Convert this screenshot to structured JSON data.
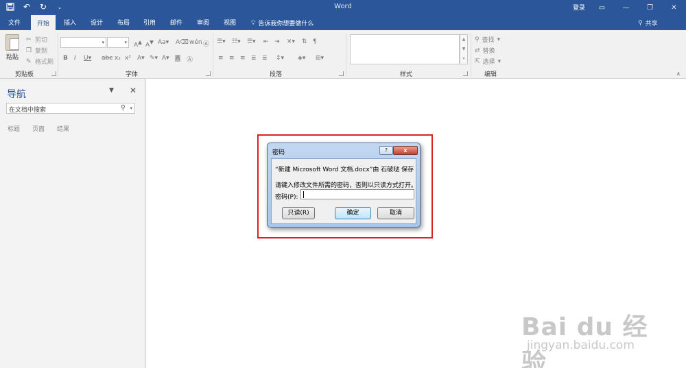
{
  "window": {
    "title": "Word",
    "login": "登录",
    "share": "共享"
  },
  "ribbon_tabs": [
    "文件",
    "开始",
    "插入",
    "设计",
    "布局",
    "引用",
    "邮件",
    "审阅",
    "视图"
  ],
  "tell_me": "告诉我你想要做什么",
  "clipboard": {
    "paste": "粘贴",
    "cut": "剪切",
    "copy": "复制",
    "format_painter": "格式刷",
    "label": "剪贴板"
  },
  "groups": {
    "font": "字体",
    "paragraph": "段落",
    "styles": "样式",
    "editing": "编辑"
  },
  "editing": {
    "find": "查找",
    "replace": "替换",
    "select": "选择"
  },
  "nav": {
    "title": "导航",
    "search_placeholder": "在文档中搜索",
    "tabs": [
      "标题",
      "页面",
      "结果"
    ]
  },
  "dialog": {
    "title": "密码",
    "help": "?",
    "close": "x",
    "message": "“新建 Microsoft Word 文档.docx”由 石破哒 保存",
    "instruction": "请键入修改文件所需的密码，否则以只读方式打开。",
    "password_label": "密码(P):",
    "password_value": "",
    "buttons": {
      "readonly": "只读(R)",
      "ok": "确定",
      "cancel": "取消"
    }
  },
  "watermark": {
    "brand": "Bai du 经验",
    "url": "jingyan.baidu.com"
  },
  "icons": [
    "save-icon",
    "undo-icon",
    "redo-icon",
    "customize-qat-icon",
    "ribbon-display-icon",
    "minimize-icon",
    "restore-icon",
    "close-icon",
    "lightbulb-icon",
    "person-icon",
    "search-icon"
  ],
  "colors": {
    "titlebar": "#2b579a",
    "highlight_frame": "#e02020"
  }
}
